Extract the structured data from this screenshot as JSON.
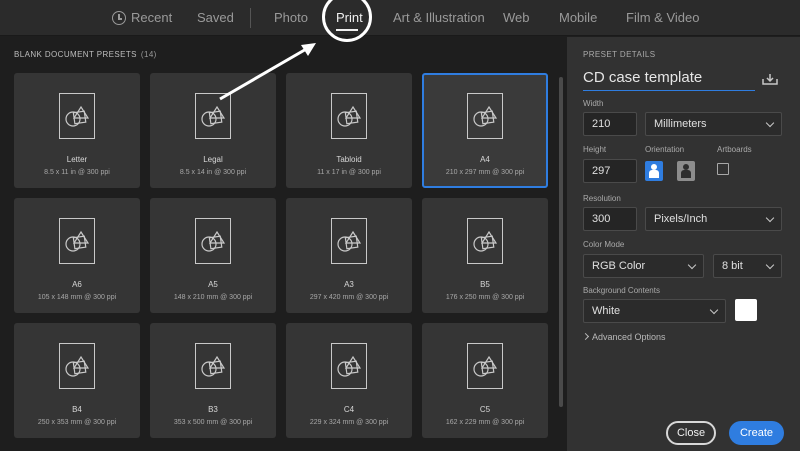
{
  "tabs": [
    {
      "label": "Recent",
      "icon": "clock-icon"
    },
    {
      "label": "Saved"
    },
    {
      "label": "Photo"
    },
    {
      "label": "Print",
      "active": true
    },
    {
      "label": "Art & Illustration"
    },
    {
      "label": "Web"
    },
    {
      "label": "Mobile"
    },
    {
      "label": "Film & Video"
    }
  ],
  "presets": {
    "header": "BLANK DOCUMENT PRESETS",
    "count": "(14)",
    "items": [
      {
        "name": "Letter",
        "size": "8.5 x 11 in @ 300 ppi"
      },
      {
        "name": "Legal",
        "size": "8.5 x 14 in @ 300 ppi"
      },
      {
        "name": "Tabloid",
        "size": "11 x 17 in @ 300 ppi"
      },
      {
        "name": "A4",
        "size": "210 x 297 mm @ 300 ppi",
        "selected": true
      },
      {
        "name": "A6",
        "size": "105 x 148 mm @ 300 ppi"
      },
      {
        "name": "A5",
        "size": "148 x 210 mm @ 300 ppi"
      },
      {
        "name": "A3",
        "size": "297 x 420 mm @ 300 ppi"
      },
      {
        "name": "B5",
        "size": "176 x 250 mm @ 300 ppi"
      },
      {
        "name": "B4",
        "size": "250 x 353 mm @ 300 ppi"
      },
      {
        "name": "B3",
        "size": "353 x 500 mm @ 300 ppi"
      },
      {
        "name": "C4",
        "size": "229 x 324 mm @ 300 ppi"
      },
      {
        "name": "C5",
        "size": "162 x 229 mm @ 300 ppi"
      }
    ]
  },
  "details": {
    "title": "PRESET DETAILS",
    "document_name": "CD case template",
    "width_label": "Width",
    "width_value": "210",
    "width_unit": "Millimeters",
    "height_label": "Height",
    "height_value": "297",
    "orientation_label": "Orientation",
    "artboards_label": "Artboards",
    "resolution_label": "Resolution",
    "resolution_value": "300",
    "resolution_unit": "Pixels/Inch",
    "color_mode_label": "Color Mode",
    "color_mode_value": "RGB Color",
    "bit_depth_value": "8 bit",
    "background_label": "Background Contents",
    "background_value": "White",
    "background_swatch": "#ffffff",
    "advanced_label": "Advanced Options",
    "close_label": "Close",
    "create_label": "Create"
  },
  "colors": {
    "accent": "#2f7de0"
  }
}
